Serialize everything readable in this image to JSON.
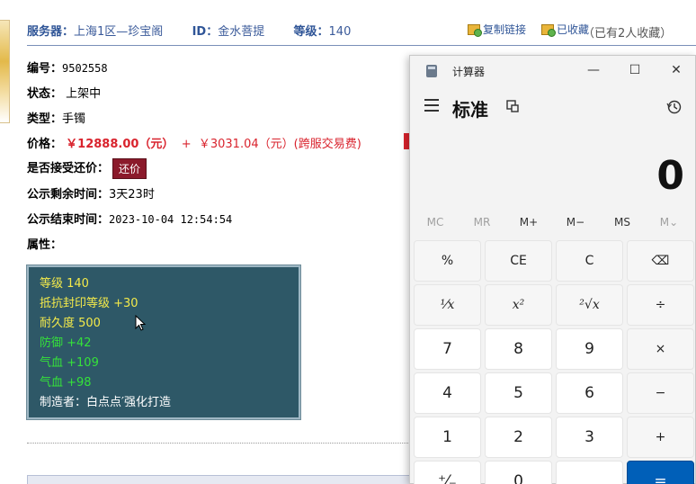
{
  "header": {
    "server_label": "服务器：",
    "server_value": "上海1区—珍宝阁",
    "id_label": "ID：",
    "id_value": "金水菩提",
    "level_label": "等级：",
    "level_value": "140",
    "copy_link": "复制链接",
    "favorited": "已收藏",
    "fav_count": "（已有2人收藏）"
  },
  "item": {
    "number_label": "编号：",
    "number_value": "9502558",
    "status_label": "状态：",
    "status_value": "上架中",
    "type_label": "类型：",
    "type_value": "手镯",
    "price_label": "价格：",
    "price_main": "￥12888.00（元）",
    "price_plus": "+",
    "price_fee": "￥3031.04（元）(跨服交易费)",
    "counter_label": "是否接受还价：",
    "counter_button": "还价",
    "remaining_label": "公示剩余时间：",
    "remaining_value": "3天23时",
    "end_label": "公示结束时间：",
    "end_value": "2023-10-04 12:54:54",
    "attr_label": "属性："
  },
  "attributes": [
    {
      "text": "等级 140",
      "color": "yellow"
    },
    {
      "text": "抵抗封印等级 +30",
      "color": "yellow"
    },
    {
      "text": "耐久度 500",
      "color": "yellow"
    },
    {
      "text": "防御 +42",
      "color": "green"
    },
    {
      "text": "气血 +109",
      "color": "green"
    },
    {
      "text": "气血 +98",
      "color": "green"
    },
    {
      "text": "制造者：白点点′强化打造",
      "color": "white"
    }
  ],
  "calculator": {
    "title": "计算器",
    "mode": "标准",
    "display": "0",
    "window_buttons": {
      "minimize": "—",
      "maximize": "☐",
      "close": "✕"
    },
    "memory": [
      "MC",
      "MR",
      "M+",
      "M−",
      "MS",
      "M⌄"
    ],
    "keys": {
      "percent": "%",
      "ce": "CE",
      "c": "C",
      "backspace": "⌫",
      "reciprocal": "¹⁄x",
      "square": "x²",
      "sqrt": "²√x",
      "divide": "÷",
      "seven": "7",
      "eight": "8",
      "nine": "9",
      "multiply": "×",
      "four": "4",
      "five": "5",
      "six": "6",
      "minus": "−",
      "one": "1",
      "two": "2",
      "three": "3",
      "plus": "+",
      "negate": "⁺⁄₋",
      "zero": "0",
      "decimal": ".",
      "equals": "="
    }
  },
  "colors": {
    "accent_blue": "#005fb8",
    "price_red": "#d9232d",
    "attr_bg": "#2e5867"
  }
}
